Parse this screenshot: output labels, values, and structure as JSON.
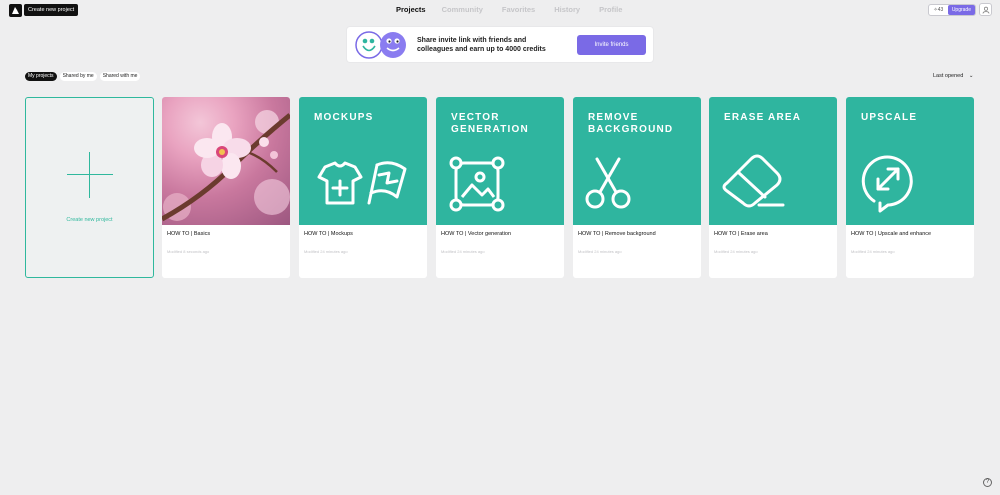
{
  "topbar": {
    "create_label": "Create new project",
    "tabs": [
      "Projects",
      "Community",
      "Favorites",
      "History",
      "Profile"
    ],
    "credits": "43",
    "upgrade_label": "Upgrade"
  },
  "banner": {
    "text": "Share invite link with friends and colleagues and earn up to 4000 credits",
    "button_label": "Invite friends"
  },
  "filters": {
    "chips": [
      "My projects",
      "Shared by me",
      "Shared with me"
    ],
    "sort_label": "Last opened"
  },
  "new_project_label": "Create new project",
  "cards": [
    {
      "title": "",
      "name": "HOW TO | Basics",
      "modified": "Modified 8 seconds ago",
      "icon": "cherry-blossom-photo"
    },
    {
      "title": "MOCKUPS",
      "name": "HOW TO | Mockups",
      "modified": "Modified 24 minutes ago",
      "icon": "tshirt-flag-icon"
    },
    {
      "title": "VECTOR GENERATION",
      "name": "HOW TO | Vector generation",
      "modified": "Modified 24 minutes ago",
      "icon": "vector-image-icon"
    },
    {
      "title": "REMOVE BACKGROUND",
      "name": "HOW TO | Remove background",
      "modified": "Modified 24 minutes ago",
      "icon": "scissors-icon"
    },
    {
      "title": "ERASE AREA",
      "name": "HOW TO | Erase area",
      "modified": "Modified 24 minutes ago",
      "icon": "eraser-icon"
    },
    {
      "title": "UPSCALE",
      "name": "HOW TO | Upscale and enhance",
      "modified": "Modified 24 minutes ago",
      "icon": "upscale-icon"
    }
  ],
  "colors": {
    "accent": "#7a6ae6",
    "teal": "#2fb59f",
    "background": "#eeeeef"
  },
  "help_label": "?"
}
